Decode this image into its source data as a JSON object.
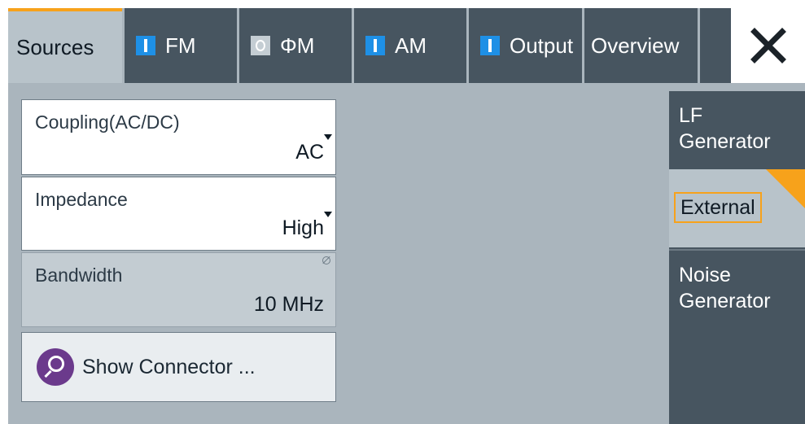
{
  "tabs": {
    "sources": "Sources",
    "fm": "FM",
    "pm": "ΦM",
    "am": "AM",
    "output": "Output",
    "overview": "Overview"
  },
  "fields": {
    "coupling": {
      "label": "Coupling(AC/DC)",
      "value": "AC"
    },
    "impedance": {
      "label": "Impedance",
      "value": "High"
    },
    "bandwidth": {
      "label": "Bandwidth",
      "value": "10 MHz"
    }
  },
  "show_connector": "Show Connector ...",
  "side": {
    "lf_line1": "LF",
    "lf_line2": "Generator",
    "external": "External",
    "noise_line1": "Noise",
    "noise_line2": "Generator"
  },
  "colors": {
    "active_accent": "#f7a21b",
    "indicator_on": "#1e90e6",
    "tab_dark": "#475560",
    "panel_bg": "#aab5bd"
  }
}
